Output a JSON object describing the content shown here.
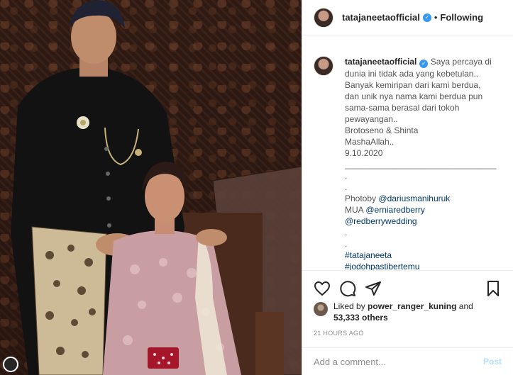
{
  "post": {
    "username": "tatajaneetaofficial",
    "verified_icon": "verified-badge-icon",
    "separator": "•",
    "follow_status": "Following"
  },
  "caption": {
    "username": "tatajaneetaofficial",
    "lines": [
      "Saya percaya di",
      "dunia ini tidak ada yang kebetulan..",
      "Banyak kemiripan dari kami berdua,",
      "dan unik nya nama kami berdua pun",
      "sama-sama berasal dari tokoh",
      "pewayangan..",
      "Brotoseno & Shinta",
      "MashaAllah..",
      "9.10.2020",
      "________________________________",
      ".",
      "."
    ],
    "photo_by_label": "Photoby",
    "photo_by_link": "@dariusmanihuruk",
    "mua_label": "MUA",
    "mua_link": "@erniaredberry",
    "mua_link2": "@redberrywedding",
    "dots2": [
      ".",
      "."
    ],
    "hashtags": [
      "#tatajaneeta",
      "#jodohpastibertemu"
    ]
  },
  "actions": {
    "icons": [
      "heart-icon",
      "comment-icon",
      "share-icon",
      "bookmark-icon"
    ]
  },
  "likes": {
    "prefix": "Liked by",
    "user": "power_ranger_kuning",
    "conj": "and",
    "count": "53,333 others"
  },
  "timestamp": "21 HOURS AGO",
  "comment_box": {
    "placeholder": "Add a comment...",
    "post_label": "Post"
  },
  "colors": {
    "accent_blue": "#3897f0",
    "link": "#00376b",
    "post_disabled": "#b2dffc",
    "muted": "#8e8e8e"
  }
}
